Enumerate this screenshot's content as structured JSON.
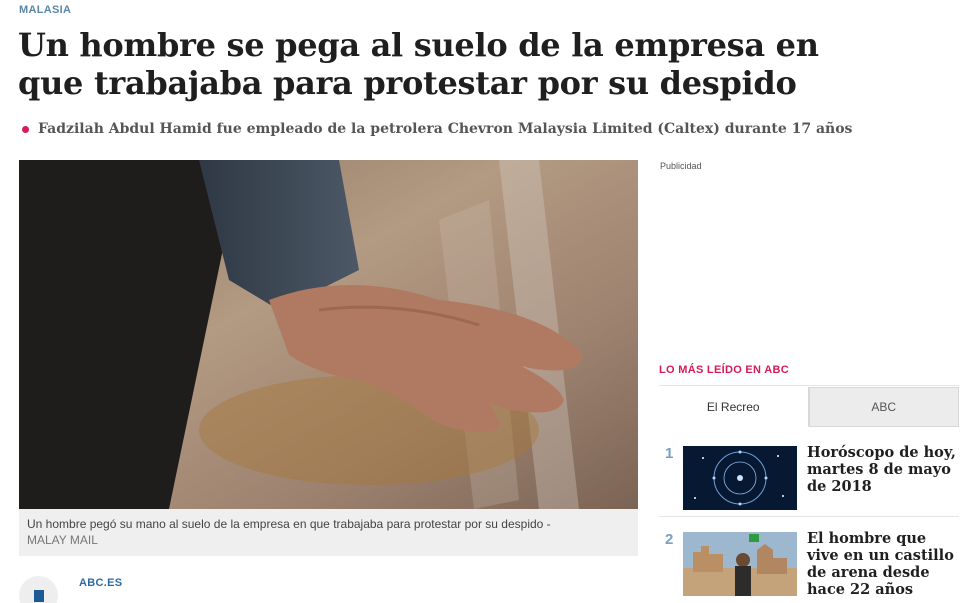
{
  "article": {
    "section": "MALASIA",
    "headline": "Un hombre se pega al suelo de la empresa en que trabajaba para protestar por su despido",
    "subhead": "Fadzilah Abdul Hamid fue empleado de la petrolera Chevron Malaysia Limited (Caltex) durante 17 años",
    "photo": {
      "alt": "Hand glued to marble floor",
      "caption": "Un hombre pegó su mano al suelo de la empresa en que trabajaba para protestar por su despido -",
      "credit": "MALAY MAIL"
    },
    "author": "ABC.ES"
  },
  "sidebar": {
    "ad_label": "Publicidad",
    "most_read": {
      "title": "LO MÁS LEÍDO EN ABC",
      "tabs": [
        {
          "label": "El Recreo",
          "active": true
        },
        {
          "label": "ABC",
          "active": false
        }
      ],
      "items": [
        {
          "rank": "1",
          "title": "Horóscopo de hoy, martes 8 de mayo de 2018",
          "thumb": "zodiac-wheel"
        },
        {
          "rank": "2",
          "title": "El hombre que vive en un castillo de arena desde hace 22 años",
          "thumb": "sand-castle"
        }
      ]
    }
  },
  "colors": {
    "accent": "#d61a5a",
    "section": "#5a86a8",
    "link": "#2b6aa4"
  }
}
